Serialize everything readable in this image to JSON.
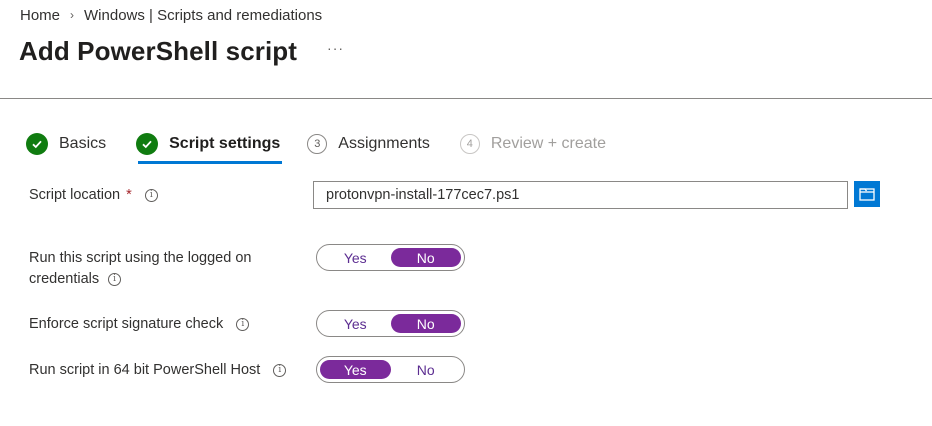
{
  "breadcrumb": {
    "home": "Home",
    "section": "Windows | Scripts and remediations",
    "separator": "›"
  },
  "header": {
    "title": "Add PowerShell script",
    "more": "···"
  },
  "steps": [
    {
      "number": "",
      "label": "Basics",
      "state": "completed"
    },
    {
      "number": "",
      "label": "Script settings",
      "state": "current-completed"
    },
    {
      "number": "3",
      "label": "Assignments",
      "state": "pending"
    },
    {
      "number": "4",
      "label": "Review + create",
      "state": "disabled"
    }
  ],
  "form": {
    "script_location": {
      "label": "Script location",
      "required": "*",
      "value": "protonvpn-install-177cec7.ps1"
    },
    "run_as_logged_on": {
      "label_line1": "Run this script using the logged on",
      "label_line2": "credentials",
      "yes": "Yes",
      "no": "No",
      "selected": "No"
    },
    "enforce_signature": {
      "label": "Enforce script signature check",
      "yes": "Yes",
      "no": "No",
      "selected": "No"
    },
    "run_64bit": {
      "label": "Run script in 64 bit PowerShell Host",
      "yes": "Yes",
      "no": "No",
      "selected": "Yes"
    }
  },
  "icons": {
    "info": "info-icon",
    "checkmark": "check-circle-icon",
    "browse": "folder-open-icon"
  },
  "colors": {
    "accent": "#0078d4",
    "toggle_on": "#7b2a9b",
    "success": "#107c10",
    "required": "#a4262c"
  }
}
